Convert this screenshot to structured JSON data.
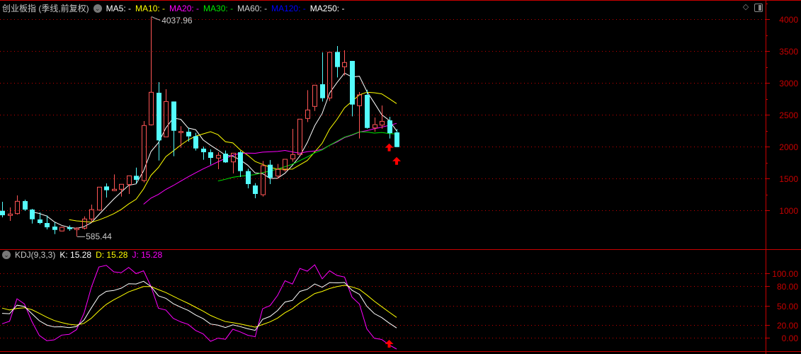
{
  "header": {
    "title": "创业板指 (季线,前复权)",
    "ma_legend": [
      {
        "label": "MA5: -",
        "color": "#ffffff"
      },
      {
        "label": "MA10: -",
        "color": "#ffff00"
      },
      {
        "label": "MA20: -",
        "color": "#ff00ff"
      },
      {
        "label": "MA30: -",
        "color": "#00e600"
      },
      {
        "label": "MA60: -",
        "color": "#d0d0d0"
      },
      {
        "label": "MA120: -",
        "color": "#0000ff"
      },
      {
        "label": "MA250: -",
        "color": "#ffffff"
      }
    ],
    "icons": [
      "collapse-chevron-icon",
      "diamond-icon",
      "panel-toggle-icon"
    ]
  },
  "indicator": {
    "name": "KDJ(9,3,3)",
    "k_label": "K: 15.28",
    "d_label": "D: 15.28",
    "j_label": "J: 15.28",
    "colors": {
      "K": "#ffffff",
      "D": "#ffff00",
      "J": "#ff00ff"
    }
  },
  "colors": {
    "up": "#ff5555",
    "down": "#54fcfc",
    "grid": "#c80000",
    "axis": "#c80000"
  },
  "chart_data": [
    {
      "type": "candlestick",
      "title": "创业板指 (季线,前复权)",
      "ylim": [
        389,
        4300
      ],
      "yticks": [
        "4000",
        "3500",
        "3000",
        "2500",
        "2000",
        "1500",
        "1000"
      ],
      "ytick_values": [
        4000,
        3500,
        3000,
        2500,
        2000,
        1500,
        1000
      ],
      "grid": true,
      "ohlc_fields": [
        "open",
        "high",
        "low",
        "close"
      ],
      "candles": [
        [
          992,
          1133,
          889,
          922
        ],
        [
          919,
          1044,
          833,
          941
        ],
        [
          948,
          1233,
          933,
          1141
        ],
        [
          1144,
          1167,
          989,
          1011
        ],
        [
          1011,
          1022,
          792,
          859
        ],
        [
          856,
          967,
          781,
          800
        ],
        [
          800,
          919,
          700,
          733
        ],
        [
          744,
          811,
          626,
          692
        ],
        [
          675,
          744,
          670,
          733
        ],
        [
          733,
          763,
          678,
          704
        ],
        [
          697,
          733,
          585.44,
          719
        ],
        [
          719,
          904,
          700,
          863
        ],
        [
          863,
          1089,
          811,
          1011
        ],
        [
          1003,
          1363,
          996,
          1363
        ],
        [
          1374,
          1422,
          1200,
          1315
        ],
        [
          1308,
          1563,
          1300,
          1330
        ],
        [
          1330,
          1411,
          1215,
          1408
        ],
        [
          1404,
          1544,
          1256,
          1541
        ],
        [
          1541,
          1670,
          1422,
          1478
        ],
        [
          1467,
          2400,
          1437,
          2330
        ],
        [
          2341,
          4037.96,
          2330,
          2852
        ],
        [
          2844,
          3011,
          1781,
          2097
        ],
        [
          2152,
          2900,
          2152,
          2707
        ],
        [
          2707,
          2707,
          1848,
          2248
        ],
        [
          2219,
          2319,
          1981,
          2237
        ],
        [
          2233,
          2296,
          2078,
          2159
        ],
        [
          2163,
          2215,
          1937,
          1970
        ],
        [
          1967,
          2000,
          1793,
          1911
        ],
        [
          1911,
          1956,
          1715,
          1822
        ],
        [
          1819,
          1911,
          1644,
          1863
        ],
        [
          1889,
          1937,
          1744,
          1752
        ],
        [
          1759,
          1896,
          1578,
          1896
        ],
        [
          1911,
          1933,
          1522,
          1615
        ],
        [
          1615,
          1652,
          1344,
          1411
        ],
        [
          1389,
          1426,
          1189,
          1256
        ],
        [
          1244,
          1774,
          1215,
          1700
        ],
        [
          1715,
          1789,
          1411,
          1511
        ],
        [
          1537,
          1726,
          1493,
          1641
        ],
        [
          1633,
          1800,
          1604,
          1800
        ],
        [
          1807,
          2278,
          1763,
          1874
        ],
        [
          1874,
          2430,
          1874,
          2430
        ],
        [
          2441,
          2885,
          2385,
          2574
        ],
        [
          2630,
          2963,
          2559,
          2963
        ],
        [
          2978,
          3478,
          2707,
          2759
        ],
        [
          2763,
          3478,
          2715,
          3478
        ],
        [
          3485,
          3578,
          3085,
          3248
        ],
        [
          3252,
          3511,
          3115,
          3319
        ],
        [
          3344,
          3344,
          2474,
          2659
        ],
        [
          2641,
          2856,
          2126,
          2811
        ],
        [
          2811,
          2892,
          2281,
          2292
        ],
        [
          2292,
          2456,
          2233,
          2344
        ],
        [
          2337,
          2644,
          2281,
          2396
        ],
        [
          2411,
          2467,
          2126,
          2211
        ],
        [
          2222,
          2274,
          1992,
          1992
        ]
      ],
      "moving_averages": [
        5,
        10,
        20,
        30
      ],
      "annotations": [
        {
          "text": "4037.96",
          "candle": 21,
          "type": "high"
        },
        {
          "text": "585.44",
          "candle": 11,
          "type": "low"
        }
      ],
      "signal_arrows": [
        {
          "candle": 53,
          "direction": "up",
          "color": "#ff0000"
        },
        {
          "candle": 54,
          "direction": "up",
          "color": "#ff0000"
        }
      ]
    },
    {
      "type": "line",
      "title": "KDJ(9,3,3)",
      "ylim": [
        -21,
        136
      ],
      "yticks": [
        "100.00",
        "80.00",
        "50.00",
        "20.00",
        "0.00"
      ],
      "ytick_values": [
        100,
        80,
        50,
        20,
        0
      ],
      "grid": true,
      "series": [
        {
          "name": "K"
        },
        {
          "name": "D"
        },
        {
          "name": "J"
        }
      ],
      "signal_arrows": [
        {
          "candle": 53,
          "direction": "up",
          "color": "#ff0000"
        }
      ]
    }
  ]
}
